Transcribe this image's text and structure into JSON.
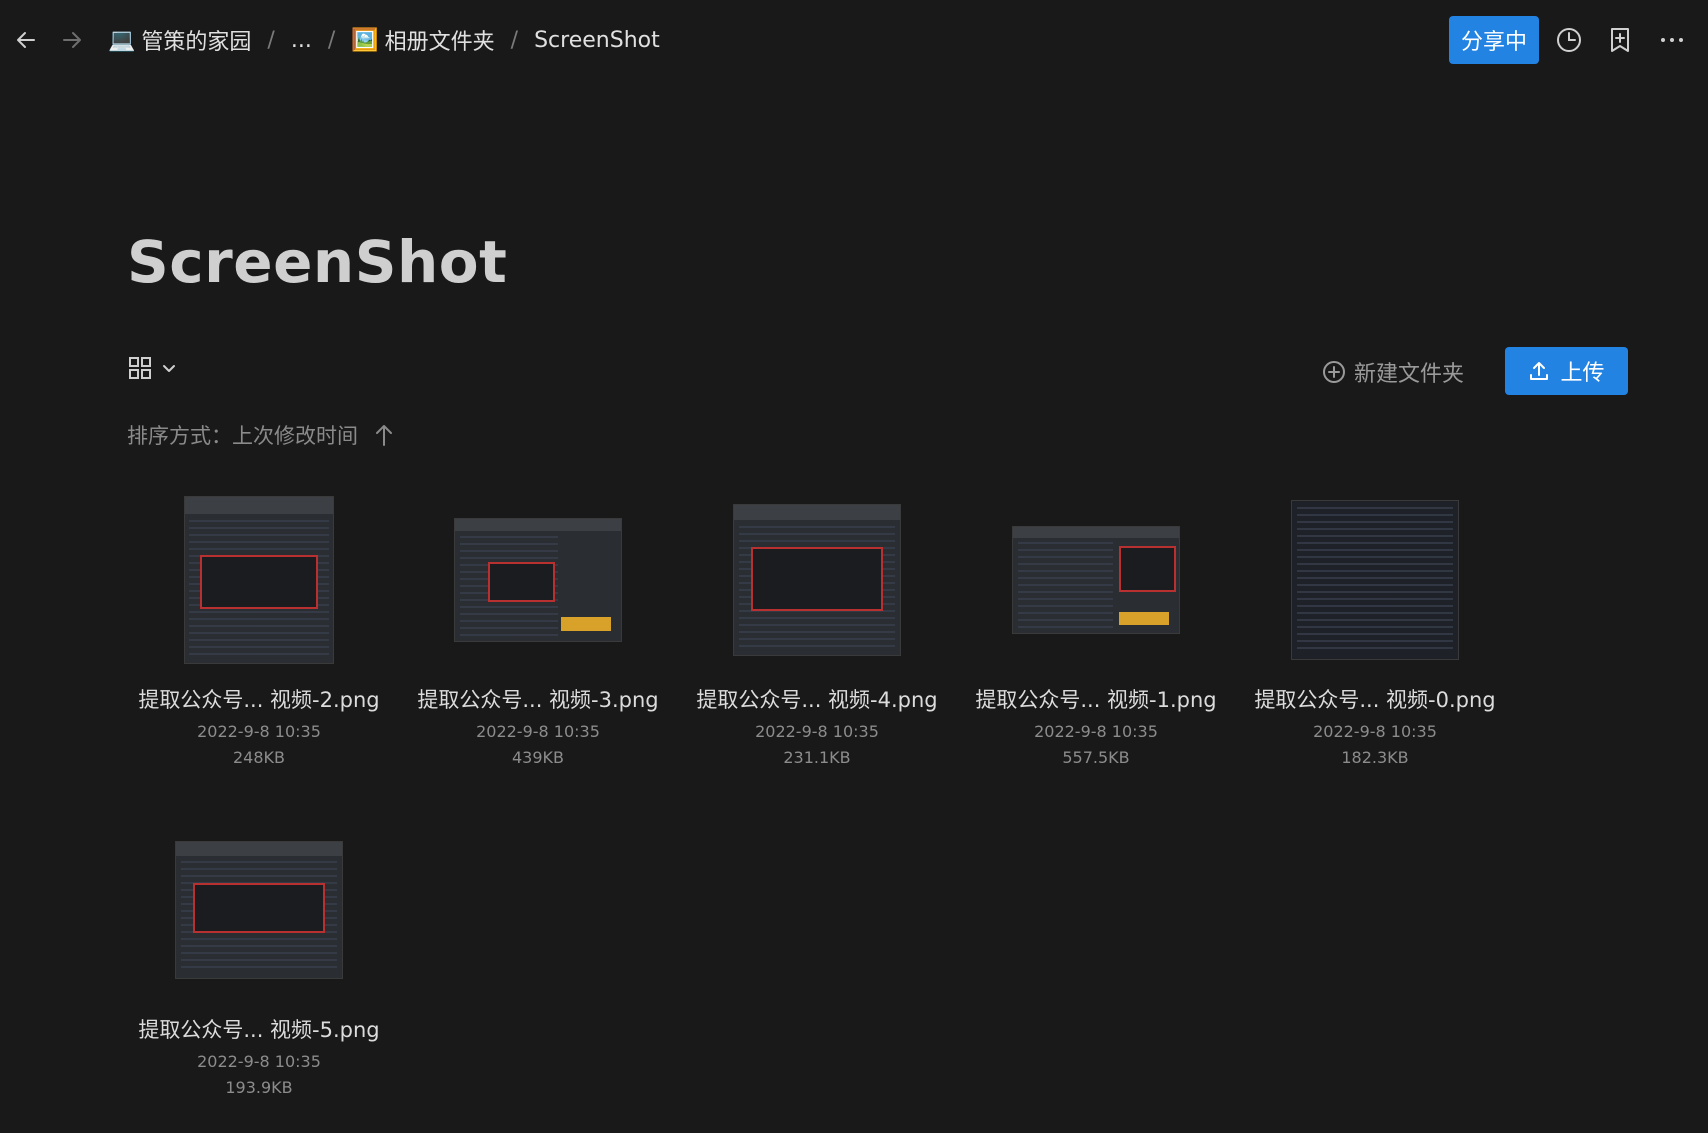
{
  "breadcrumb": {
    "items": [
      {
        "icon": "💻",
        "label": "管策的家园"
      },
      {
        "icon": "",
        "label": "..."
      },
      {
        "icon": "🖼️",
        "label": "相册文件夹"
      },
      {
        "icon": "",
        "label": "ScreenShot"
      }
    ],
    "separator": "/"
  },
  "header": {
    "share_label": "分享中",
    "icons": [
      "history-icon",
      "bookmark-add-icon",
      "more-icon"
    ]
  },
  "page": {
    "title": "ScreenShot"
  },
  "toolbar": {
    "new_folder_label": "新建文件夹",
    "upload_label": "上传",
    "sort_label": "排序方式：上次修改时间"
  },
  "files": [
    {
      "name": "提取公众号...   视频-2.png",
      "date": "2022-9-8 10:35",
      "size": "248KB"
    },
    {
      "name": "提取公众号...   视频-3.png",
      "date": "2022-9-8 10:35",
      "size": "439KB"
    },
    {
      "name": "提取公众号...   视频-4.png",
      "date": "2022-9-8 10:35",
      "size": "231.1KB"
    },
    {
      "name": "提取公众号...   视频-1.png",
      "date": "2022-9-8 10:35",
      "size": "557.5KB"
    },
    {
      "name": "提取公众号...   视频-0.png",
      "date": "2022-9-8 10:35",
      "size": "182.3KB"
    },
    {
      "name": "提取公众号...   视频-5.png",
      "date": "2022-9-8 10:35",
      "size": "193.9KB"
    }
  ],
  "colors": {
    "background": "#191919",
    "accent": "#2383e2"
  }
}
